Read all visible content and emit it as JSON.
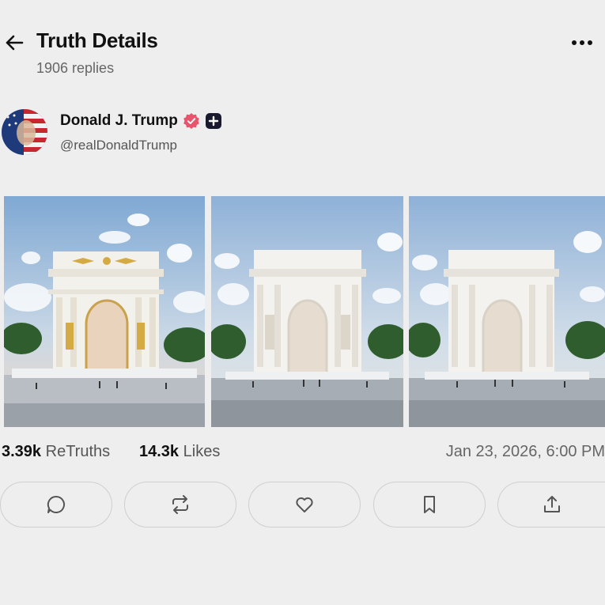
{
  "header": {
    "title": "Truth Details",
    "replies": "1906 replies"
  },
  "author": {
    "name": "Donald J. Trump",
    "handle": "@realDonaldTrump"
  },
  "media": {
    "count": 3
  },
  "stats": {
    "retruths_count": "3.39k",
    "retruths_label": "ReTruths",
    "likes_count": "14.3k",
    "likes_label": "Likes",
    "timestamp": "Jan 23, 2026, 6:00 PM"
  },
  "actions": [
    "reply-icon",
    "retruth-icon",
    "like-icon",
    "bookmark-icon",
    "share-icon"
  ],
  "colors": {
    "background": "#eeeeee",
    "verified": "#e8546c",
    "text": "#111111",
    "muted": "#666666"
  }
}
